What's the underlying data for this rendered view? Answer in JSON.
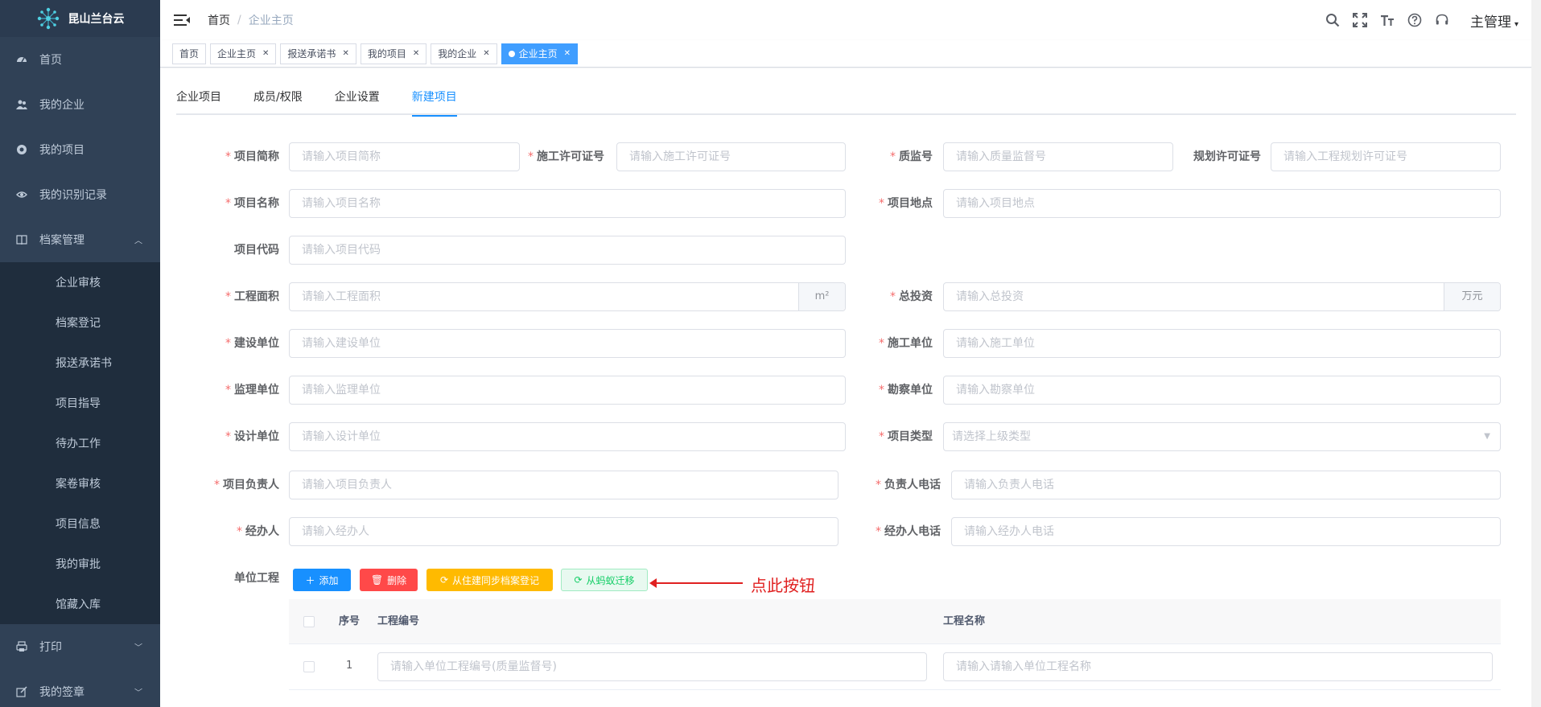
{
  "brand": {
    "title": "昆山兰台云",
    "logo_icon": "network-logo-icon"
  },
  "sidebar": {
    "items": [
      {
        "label": "首页",
        "icon": "dashboard-icon"
      },
      {
        "label": "我的企业",
        "icon": "users-icon"
      },
      {
        "label": "我的项目",
        "icon": "project-icon"
      },
      {
        "label": "我的识别记录",
        "icon": "eye-icon"
      },
      {
        "label": "档案管理",
        "icon": "book-icon",
        "expanded": true
      }
    ],
    "sub_items": [
      "企业审核",
      "档案登记",
      "报送承诺书",
      "项目指导",
      "待办工作",
      "案卷审核",
      "项目信息",
      "我的审批",
      "馆藏入库"
    ],
    "bottom_items": [
      {
        "label": "打印",
        "icon": "printer-icon"
      },
      {
        "label": "我的签章",
        "icon": "edit-icon"
      }
    ]
  },
  "header": {
    "breadcrumb": [
      "首页",
      "企业主页"
    ],
    "breadcrumb_sep": "/",
    "user": "主管理"
  },
  "tags": [
    {
      "label": "首页",
      "closable": false
    },
    {
      "label": "企业主页",
      "closable": true
    },
    {
      "label": "报送承诺书",
      "closable": true
    },
    {
      "label": "我的项目",
      "closable": true
    },
    {
      "label": "我的企业",
      "closable": true
    },
    {
      "label": "企业主页",
      "closable": true,
      "active": true
    }
  ],
  "tabs": [
    {
      "label": "企业项目"
    },
    {
      "label": "成员/权限"
    },
    {
      "label": "企业设置"
    },
    {
      "label": "新建项目",
      "active": true
    }
  ],
  "form": {
    "project_short_name": {
      "label": "项目简称",
      "required": true,
      "placeholder": "请输入项目简称"
    },
    "permit_no": {
      "label": "施工许可证号",
      "required": true,
      "placeholder": "请输入施工许可证号"
    },
    "quality_no": {
      "label": "质监号",
      "required": true,
      "placeholder": "请输入质量监督号"
    },
    "plan_permit_no": {
      "label": "规划许可证号",
      "required": false,
      "placeholder": "请输入工程规划许可证号"
    },
    "project_name": {
      "label": "项目名称",
      "required": true,
      "placeholder": "请输入项目名称"
    },
    "project_location": {
      "label": "项目地点",
      "required": true,
      "placeholder": "请输入项目地点"
    },
    "project_code": {
      "label": "项目代码",
      "required": false,
      "placeholder": "请输入项目代码"
    },
    "area": {
      "label": "工程面积",
      "required": true,
      "placeholder": "请输入工程面积",
      "unit": "m²"
    },
    "investment": {
      "label": "总投资",
      "required": true,
      "placeholder": "请输入总投资",
      "unit": "万元"
    },
    "build_unit": {
      "label": "建设单位",
      "required": true,
      "placeholder": "请输入建设单位"
    },
    "construct_unit": {
      "label": "施工单位",
      "required": true,
      "placeholder": "请输入施工单位"
    },
    "supervise_unit": {
      "label": "监理单位",
      "required": true,
      "placeholder": "请输入监理单位"
    },
    "survey_unit": {
      "label": "勘察单位",
      "required": true,
      "placeholder": "请输入勘察单位"
    },
    "design_unit": {
      "label": "设计单位",
      "required": true,
      "placeholder": "请输入设计单位"
    },
    "project_type": {
      "label": "项目类型",
      "required": true,
      "placeholder": "请选择上级类型"
    },
    "project_leader": {
      "label": "项目负责人",
      "required": true,
      "placeholder": "请输入项目负责人"
    },
    "leader_phone": {
      "label": "负责人电话",
      "required": true,
      "placeholder": "请输入负责人电话"
    },
    "handler": {
      "label": "经办人",
      "required": true,
      "placeholder": "请输入经办人"
    },
    "handler_phone": {
      "label": "经办人电话",
      "required": true,
      "placeholder": "请输入经办人电话"
    },
    "unit_project": {
      "label": "单位工程"
    }
  },
  "buttons": {
    "add": "添加",
    "delete": "删除",
    "sync": "从住建同步档案登记",
    "migrate": "从蚂蚁迁移"
  },
  "annotation": {
    "text": "点此按钮",
    "color": "#e02020"
  },
  "table": {
    "columns": [
      "序号",
      "工程编号",
      "工程名称"
    ],
    "rows": [
      {
        "index": "1",
        "code_placeholder": "请输入单位工程编号(质量监督号)",
        "name_placeholder": "请输入请输入单位工程名称"
      }
    ]
  },
  "colors": {
    "sidebar_bg": "#304156",
    "submenu_bg": "#1f2d3d",
    "accent": "#1890ff",
    "danger": "#ff4949",
    "warning": "#ffba00",
    "success": "#13ce66",
    "required": "#f56c6c"
  }
}
